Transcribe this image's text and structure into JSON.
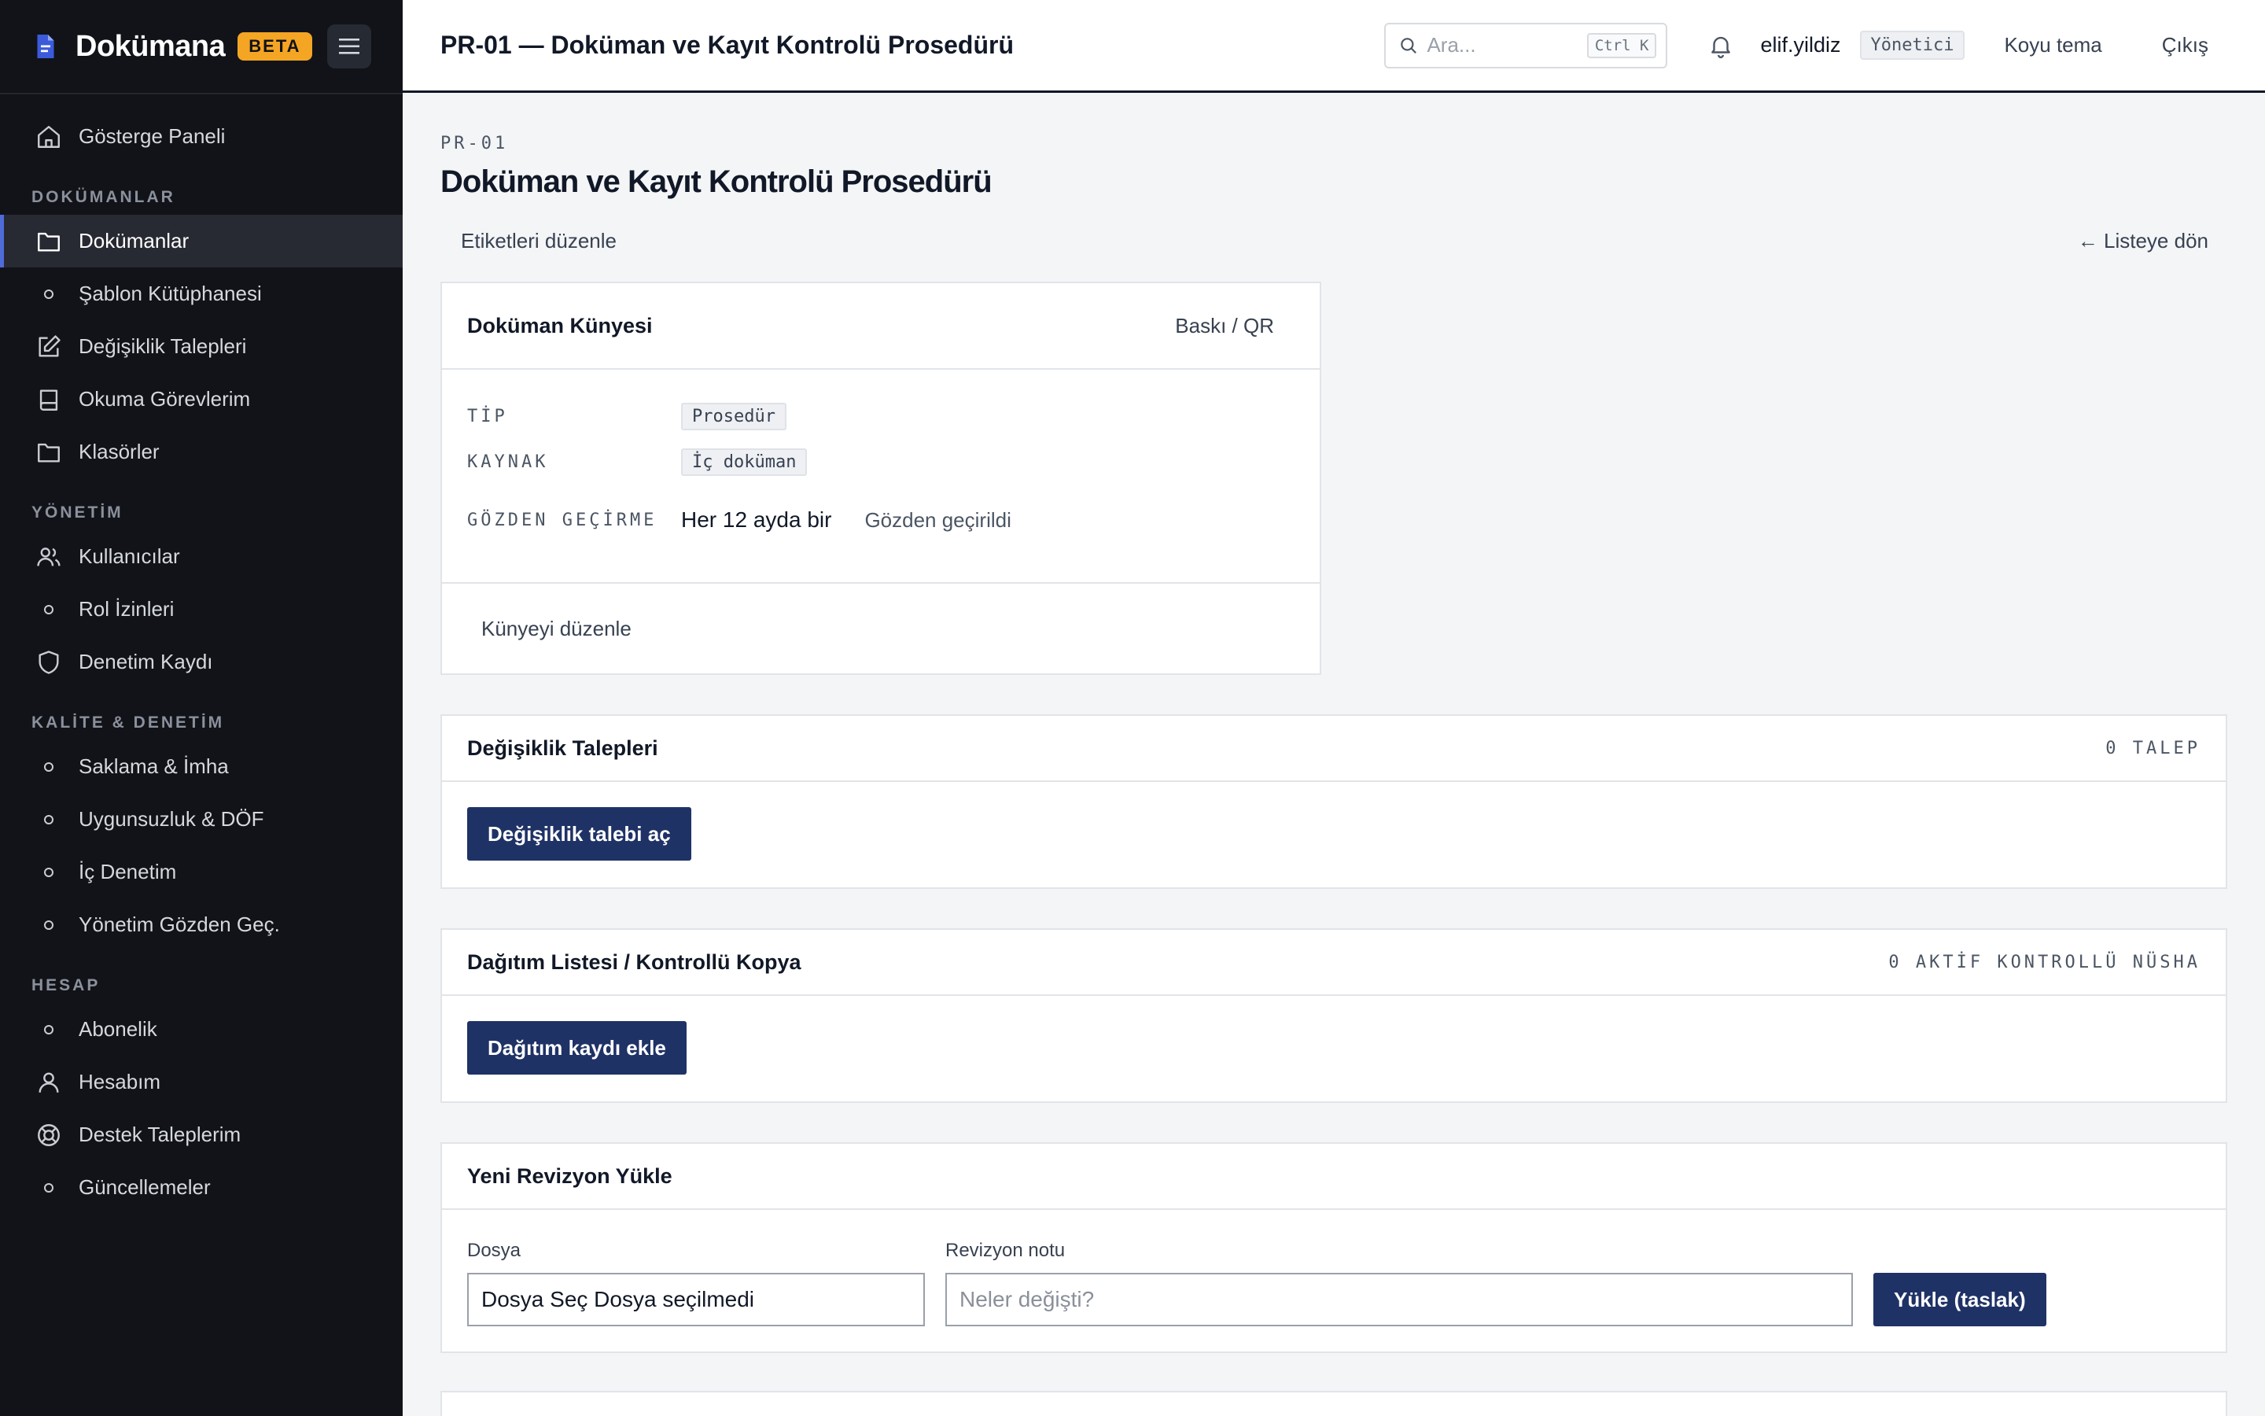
{
  "brand": {
    "name": "Dokümana",
    "badge": "BETA"
  },
  "sidebar": {
    "top_item": {
      "label": "Gösterge Paneli",
      "icon": "home-icon"
    },
    "sections": [
      {
        "title": "DOKÜMANLAR",
        "items": [
          {
            "label": "Dokümanlar",
            "icon": "folder-icon",
            "active": true
          },
          {
            "label": "Şablon Kütüphanesi",
            "icon": "dot-icon"
          },
          {
            "label": "Değişiklik Talepleri",
            "icon": "edit-icon"
          },
          {
            "label": "Okuma Görevlerim",
            "icon": "book-icon"
          },
          {
            "label": "Klasörler",
            "icon": "folder-icon"
          }
        ]
      },
      {
        "title": "YÖNETİM",
        "items": [
          {
            "label": "Kullanıcılar",
            "icon": "users-icon"
          },
          {
            "label": "Rol İzinleri",
            "icon": "dot-icon"
          },
          {
            "label": "Denetim Kaydı",
            "icon": "shield-icon"
          }
        ]
      },
      {
        "title": "KALİTE & DENETİM",
        "items": [
          {
            "label": "Saklama & İmha",
            "icon": "dot-icon"
          },
          {
            "label": "Uygunsuzluk & DÖF",
            "icon": "dot-icon"
          },
          {
            "label": "İç Denetim",
            "icon": "dot-icon"
          },
          {
            "label": "Yönetim Gözden Geç.",
            "icon": "dot-icon"
          }
        ]
      },
      {
        "title": "HESAP",
        "items": [
          {
            "label": "Abonelik",
            "icon": "dot-icon"
          },
          {
            "label": "Hesabım",
            "icon": "user-icon"
          },
          {
            "label": "Destek Taleplerim",
            "icon": "lifebuoy-icon"
          },
          {
            "label": "Güncellemeler",
            "icon": "dot-icon"
          }
        ]
      }
    ]
  },
  "topbar": {
    "title": "PR-01 — Doküman ve Kayıt Kontrolü Prosedürü",
    "search_placeholder": "Ara...",
    "search_shortcut": "Ctrl K",
    "username": "elif.yildiz",
    "role": "Yönetici",
    "theme_label": "Koyu tema",
    "logout_label": "Çıkış"
  },
  "document": {
    "code": "PR-01",
    "title": "Doküman ve Kayıt Kontrolü Prosedürü",
    "edit_tags_label": "Etiketleri düzenle",
    "back_label": "← Listeye dön"
  },
  "kunye": {
    "title": "Doküman Künyesi",
    "print_label": "Baskı / QR",
    "type_key": "TİP",
    "type_value": "Prosedür",
    "source_key": "KAYNAK",
    "source_value": "İç doküman",
    "review_key": "GÖZDEN GEÇİRME",
    "review_value": "Her 12 ayda bir",
    "review_status": "Gözden geçirildi",
    "edit_label": "Künyeyi düzenle"
  },
  "change_requests": {
    "title": "Değişiklik Talepleri",
    "count_label": "0 TALEP",
    "button": "Değişiklik talebi aç"
  },
  "distribution": {
    "title": "Dağıtım Listesi / Kontrollü Kopya",
    "count_label": "0 AKTİF KONTROLLÜ NÜSHA",
    "button": "Dağıtım kaydı ekle"
  },
  "revision": {
    "title": "Yeni Revizyon Yükle",
    "file_label": "Dosya",
    "file_value": "Dosya Seç Dosya seçilmedi",
    "note_label": "Revizyon notu",
    "note_placeholder": "Neler değişti?",
    "upload_button": "Yükle (taslak)"
  },
  "colors": {
    "sidebar_bg": "#111319",
    "accent": "#4f6bd8",
    "beta_badge": "#f5a524",
    "primary_button": "#1f3266"
  }
}
